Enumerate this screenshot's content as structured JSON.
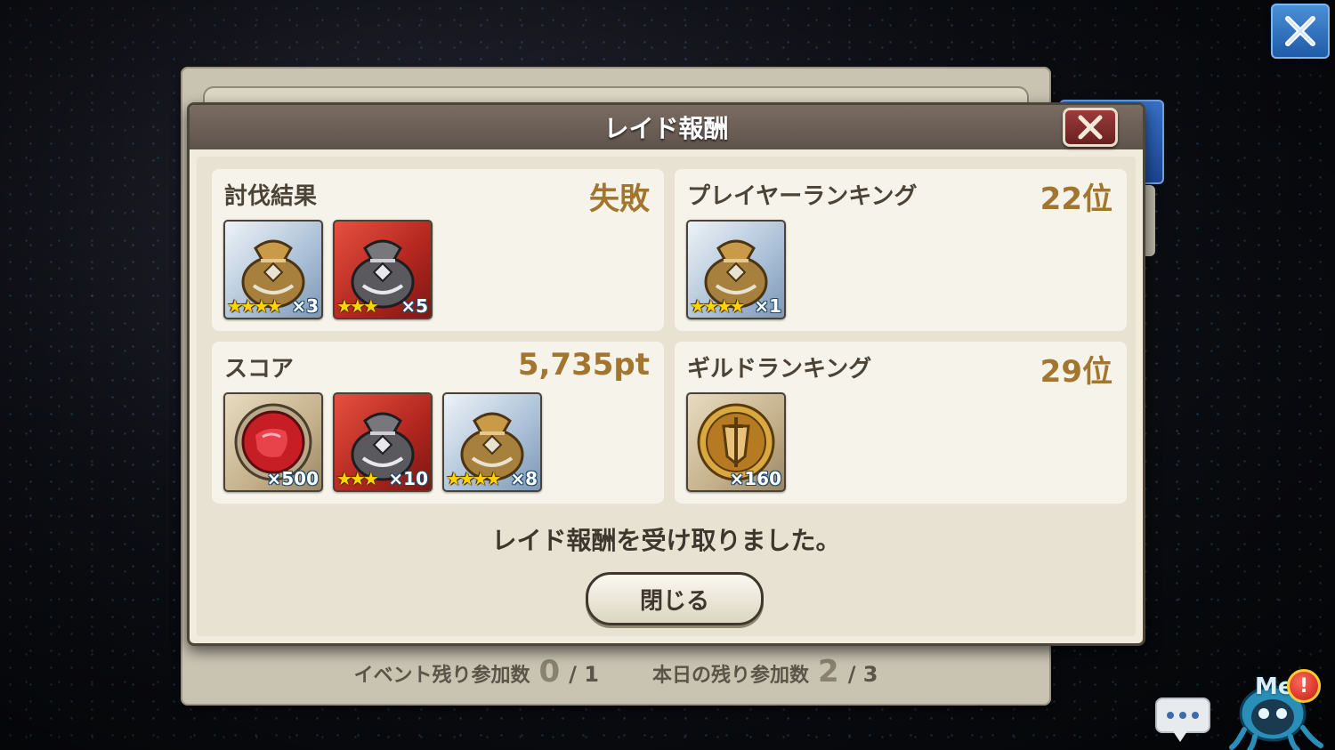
{
  "modal": {
    "title": "レイド報酬",
    "message": "レイド報酬を受け取りました。",
    "close_button": "閉じる"
  },
  "cards": {
    "subjugation": {
      "title": "討伐結果",
      "value": "失敗",
      "items": [
        {
          "icon": "gold-pouch-icon",
          "stars": "★★★★",
          "qty": "×3"
        },
        {
          "icon": "silver-pouch-icon",
          "stars": "★★★",
          "qty": "×5"
        }
      ]
    },
    "player_ranking": {
      "title": "プレイヤーランキング",
      "value": "22位",
      "items": [
        {
          "icon": "gold-pouch-icon",
          "stars": "★★★★",
          "qty": "×1"
        }
      ]
    },
    "score": {
      "title": "スコア",
      "value": "5,735pt",
      "items": [
        {
          "icon": "red-gem-icon",
          "stars": "",
          "qty": "×500"
        },
        {
          "icon": "silver-pouch-icon",
          "stars": "★★★",
          "qty": "×10"
        },
        {
          "icon": "gold-pouch-icon",
          "stars": "★★★★",
          "qty": "×8"
        }
      ]
    },
    "guild_ranking": {
      "title": "ギルドランキング",
      "value": "29位",
      "items": [
        {
          "icon": "guild-medal-icon",
          "stars": "",
          "qty": "×160"
        }
      ]
    }
  },
  "footer": {
    "event_label": "イベント残り参加数",
    "event_current": "0",
    "event_total": "/ 1",
    "daily_label": "本日の残り参加数",
    "daily_current": "2",
    "daily_total": "/ 3"
  },
  "mascot": {
    "label": "Me",
    "alert": "!"
  },
  "colors": {
    "value_gold": "#a2762f",
    "header_brown": "#6b5f56",
    "close_red": "#8a2d2d"
  }
}
